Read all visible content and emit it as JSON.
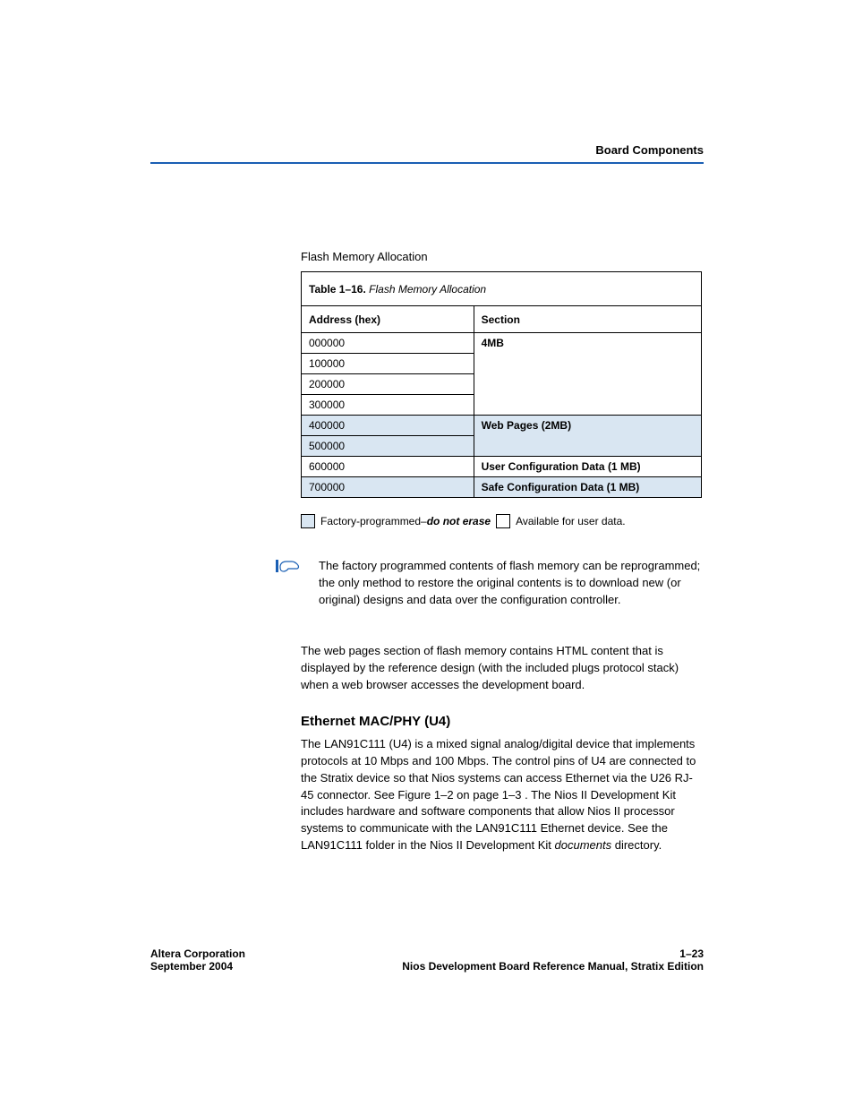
{
  "header": {
    "title": "Board Components"
  },
  "lead": "Flash Memory Allocation",
  "table": {
    "caption_bold": "Table 1–16.",
    "caption_ital": "Flash Memory Allocation",
    "head_addr": "Address (hex)",
    "head_sec": "Section",
    "rows": [
      {
        "addr": "000000",
        "sec": "4MB",
        "addr_sep": false,
        "sec_start": true,
        "shade": false
      },
      {
        "addr": "100000",
        "sec": "",
        "addr_sep": true,
        "sec_start": false,
        "shade": false
      },
      {
        "addr": "200000",
        "sec": "",
        "addr_sep": true,
        "sec_start": false,
        "shade": false
      },
      {
        "addr": "300000",
        "sec": "",
        "addr_sep": true,
        "sec_start": false,
        "shade": false
      },
      {
        "addr": "400000",
        "sec": "Web Pages (2MB)",
        "addr_sep": false,
        "sec_start": true,
        "shade": true
      },
      {
        "addr": "500000",
        "sec": "",
        "addr_sep": true,
        "sec_start": false,
        "shade": true
      },
      {
        "addr": "600000",
        "sec": "User Configuration Data (1 MB)",
        "addr_sep": false,
        "sec_start": true,
        "shade": false
      },
      {
        "addr": "700000",
        "sec": "Safe Configuration Data (1 MB)",
        "addr_sep": false,
        "sec_start": true,
        "shade": true
      }
    ]
  },
  "legend": {
    "fp_prefix": "Factory-programmed–",
    "fp_bold": "do not erase",
    "avail": "Available for user data."
  },
  "note": "The factory programmed contents of flash memory can be reprogrammed; the only method to restore the original contents is to download new (or original) designs and data over the configuration controller.",
  "body": "The web pages section of flash memory contains HTML content that is displayed by the reference design (with the included plugs protocol stack) when a web browser accesses the development board.",
  "heading": "Ethernet MAC/PHY (U4)",
  "sect": {
    "p1": "The LAN91C111 (U4) is a mixed signal analog/digital device that implements protocols at 10 Mbps and 100 Mbps. The control pins of U4 are connected to the Stratix device so that Nios systems can access Ethernet via the U26 RJ-45 connector. See ",
    "link": "Figure 1–2 on page 1–3",
    "p2": ". The Nios II Development Kit includes hardware and software components that allow Nios II processor systems to communicate with the LAN91C111 Ethernet device. See the LAN91C111 folder in the Nios II Development Kit ",
    "ital": "documents",
    "p3": " directory."
  },
  "footer": {
    "left1": "Altera Corporation",
    "right1": "1–23",
    "left2": "September 2004",
    "right2": "Nios Development Board Reference Manual, Stratix Edition"
  }
}
